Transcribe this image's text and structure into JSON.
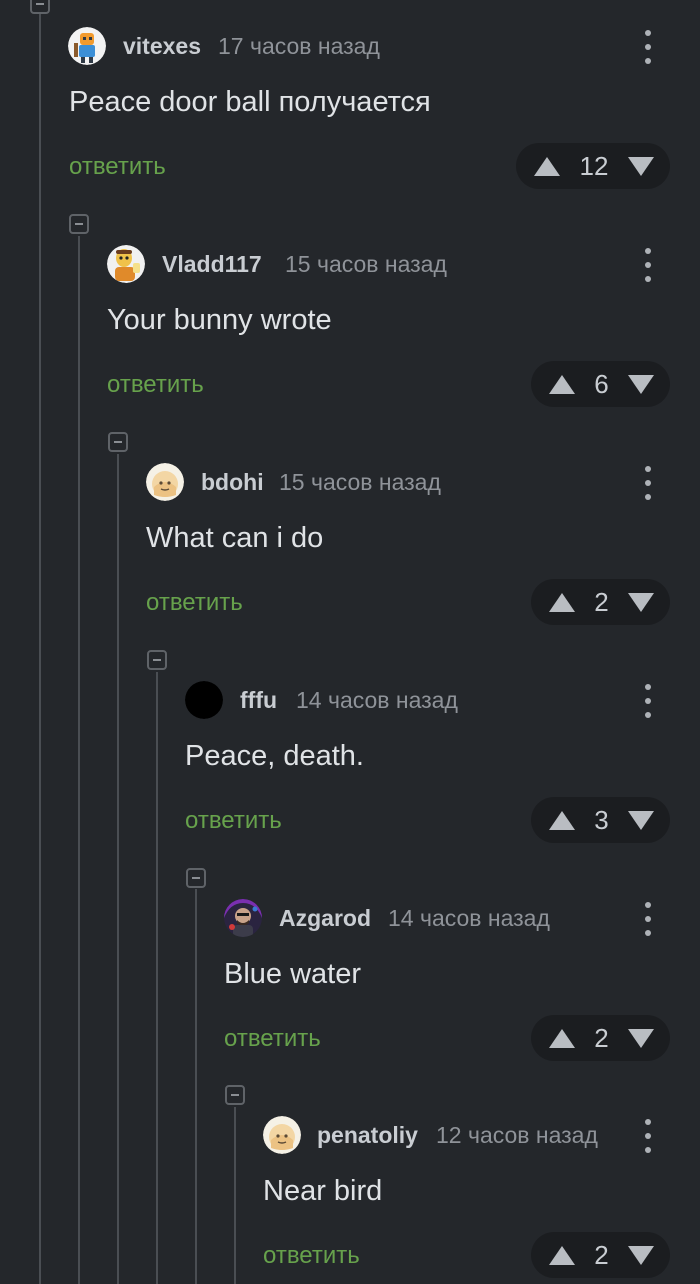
{
  "colors": {
    "background": "#24272b",
    "reply": "#67a24c",
    "username": "#c9cdd2",
    "timestamp": "#8f9399",
    "body": "#e0e3e6",
    "vote_pill": "#1b1d20"
  },
  "comments": [
    {
      "username": "vitexes",
      "time": "17 часов назад",
      "text": "Peace door ball получается",
      "reply_label": "ответить",
      "votes": "12",
      "avatar_icon": "pixel-character-avatar"
    },
    {
      "username": "Vladd117",
      "time": "15 часов назад",
      "text": "Your bunny wrote",
      "reply_label": "ответить",
      "votes": "6",
      "avatar_icon": "cartoon-man-avatar"
    },
    {
      "username": "bdohi",
      "time": "15 часов назад",
      "text": "What can i do",
      "reply_label": "ответить",
      "votes": "2",
      "avatar_icon": "peach-face-avatar"
    },
    {
      "username": "fffu",
      "time": "14 часов назад",
      "text": "Peace, death.",
      "reply_label": "ответить",
      "votes": "3",
      "avatar_icon": "black-circle-avatar"
    },
    {
      "username": "Azgarod",
      "time": "14 часов назад",
      "text": "Blue water",
      "reply_label": "ответить",
      "votes": "2",
      "avatar_icon": "dark-character-avatar"
    },
    {
      "username": "penatoliy",
      "time": "12 часов назад",
      "text": "Near bird",
      "reply_label": "ответить",
      "votes": "2",
      "avatar_icon": "peach-face-avatar"
    }
  ]
}
